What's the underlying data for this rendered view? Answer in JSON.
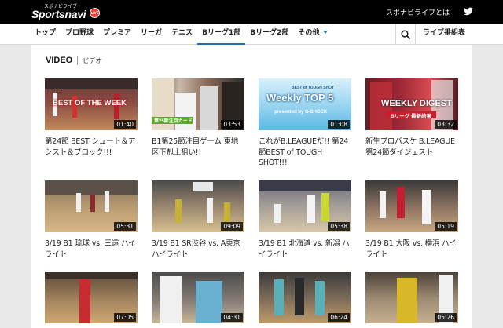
{
  "header": {
    "logo_top": "スポナビライブ",
    "logo_main": "Sportsnavi",
    "logo_live": "LIVE",
    "about_link": "スポナビライブとは"
  },
  "nav": {
    "items": [
      "トップ",
      "プロ野球",
      "プレミア",
      "リーガ",
      "テニス",
      "Bリーグ1部",
      "Bリーグ2部",
      "その他"
    ],
    "active_index": 5,
    "live_schedule": "ライブ番組表"
  },
  "section": {
    "title_en": "VIDEO",
    "title_ja": "ビデオ"
  },
  "videos": [
    {
      "caption": "第24節 BEST シュート＆アシスト＆ブロック!!!",
      "duration": "01:40",
      "overlay": "BEST OF THE WEEK"
    },
    {
      "caption": "B1第25節注目ゲーム 東地区下剋上狙い!!",
      "duration": "03:53",
      "overlay": "第25節注目カード"
    },
    {
      "caption": "これがB.LEAGUEだ!! 第24節BEST of TOUGH SHOT!!!",
      "duration": "01:08",
      "overlay": "Weekly TOP 5",
      "overlay_top": "BEST of TOUGH SHOT",
      "overlay_bottom": "presented by G-SHOCK"
    },
    {
      "caption": "新生プロバスケ B.LEAGUE 第24節ダイジェスト",
      "duration": "03:32",
      "overlay": "WEEKLY DIGEST",
      "overlay_bottom": "Bリーグ 最新結果"
    },
    {
      "caption": "3/19 B1 琉球 vs. 三遠 ハイライト",
      "duration": "05:31"
    },
    {
      "caption": "3/19 B1 SR渋谷 vs. A東京 ハイライト",
      "duration": "09:09"
    },
    {
      "caption": "3/19 B1 北海道 vs. 新潟 ハイライト",
      "duration": "05:38"
    },
    {
      "caption": "3/19 B1 大阪 vs. 横浜 ハイライト",
      "duration": "05:19"
    },
    {
      "caption": "",
      "duration": "07:05"
    },
    {
      "caption": "",
      "duration": "04:31"
    },
    {
      "caption": "",
      "duration": "06:24"
    },
    {
      "caption": "",
      "duration": "05:26"
    }
  ],
  "colors": {
    "accent": "#1d6fb8",
    "header_bg": "#000000",
    "live_badge": "#e8382f"
  }
}
